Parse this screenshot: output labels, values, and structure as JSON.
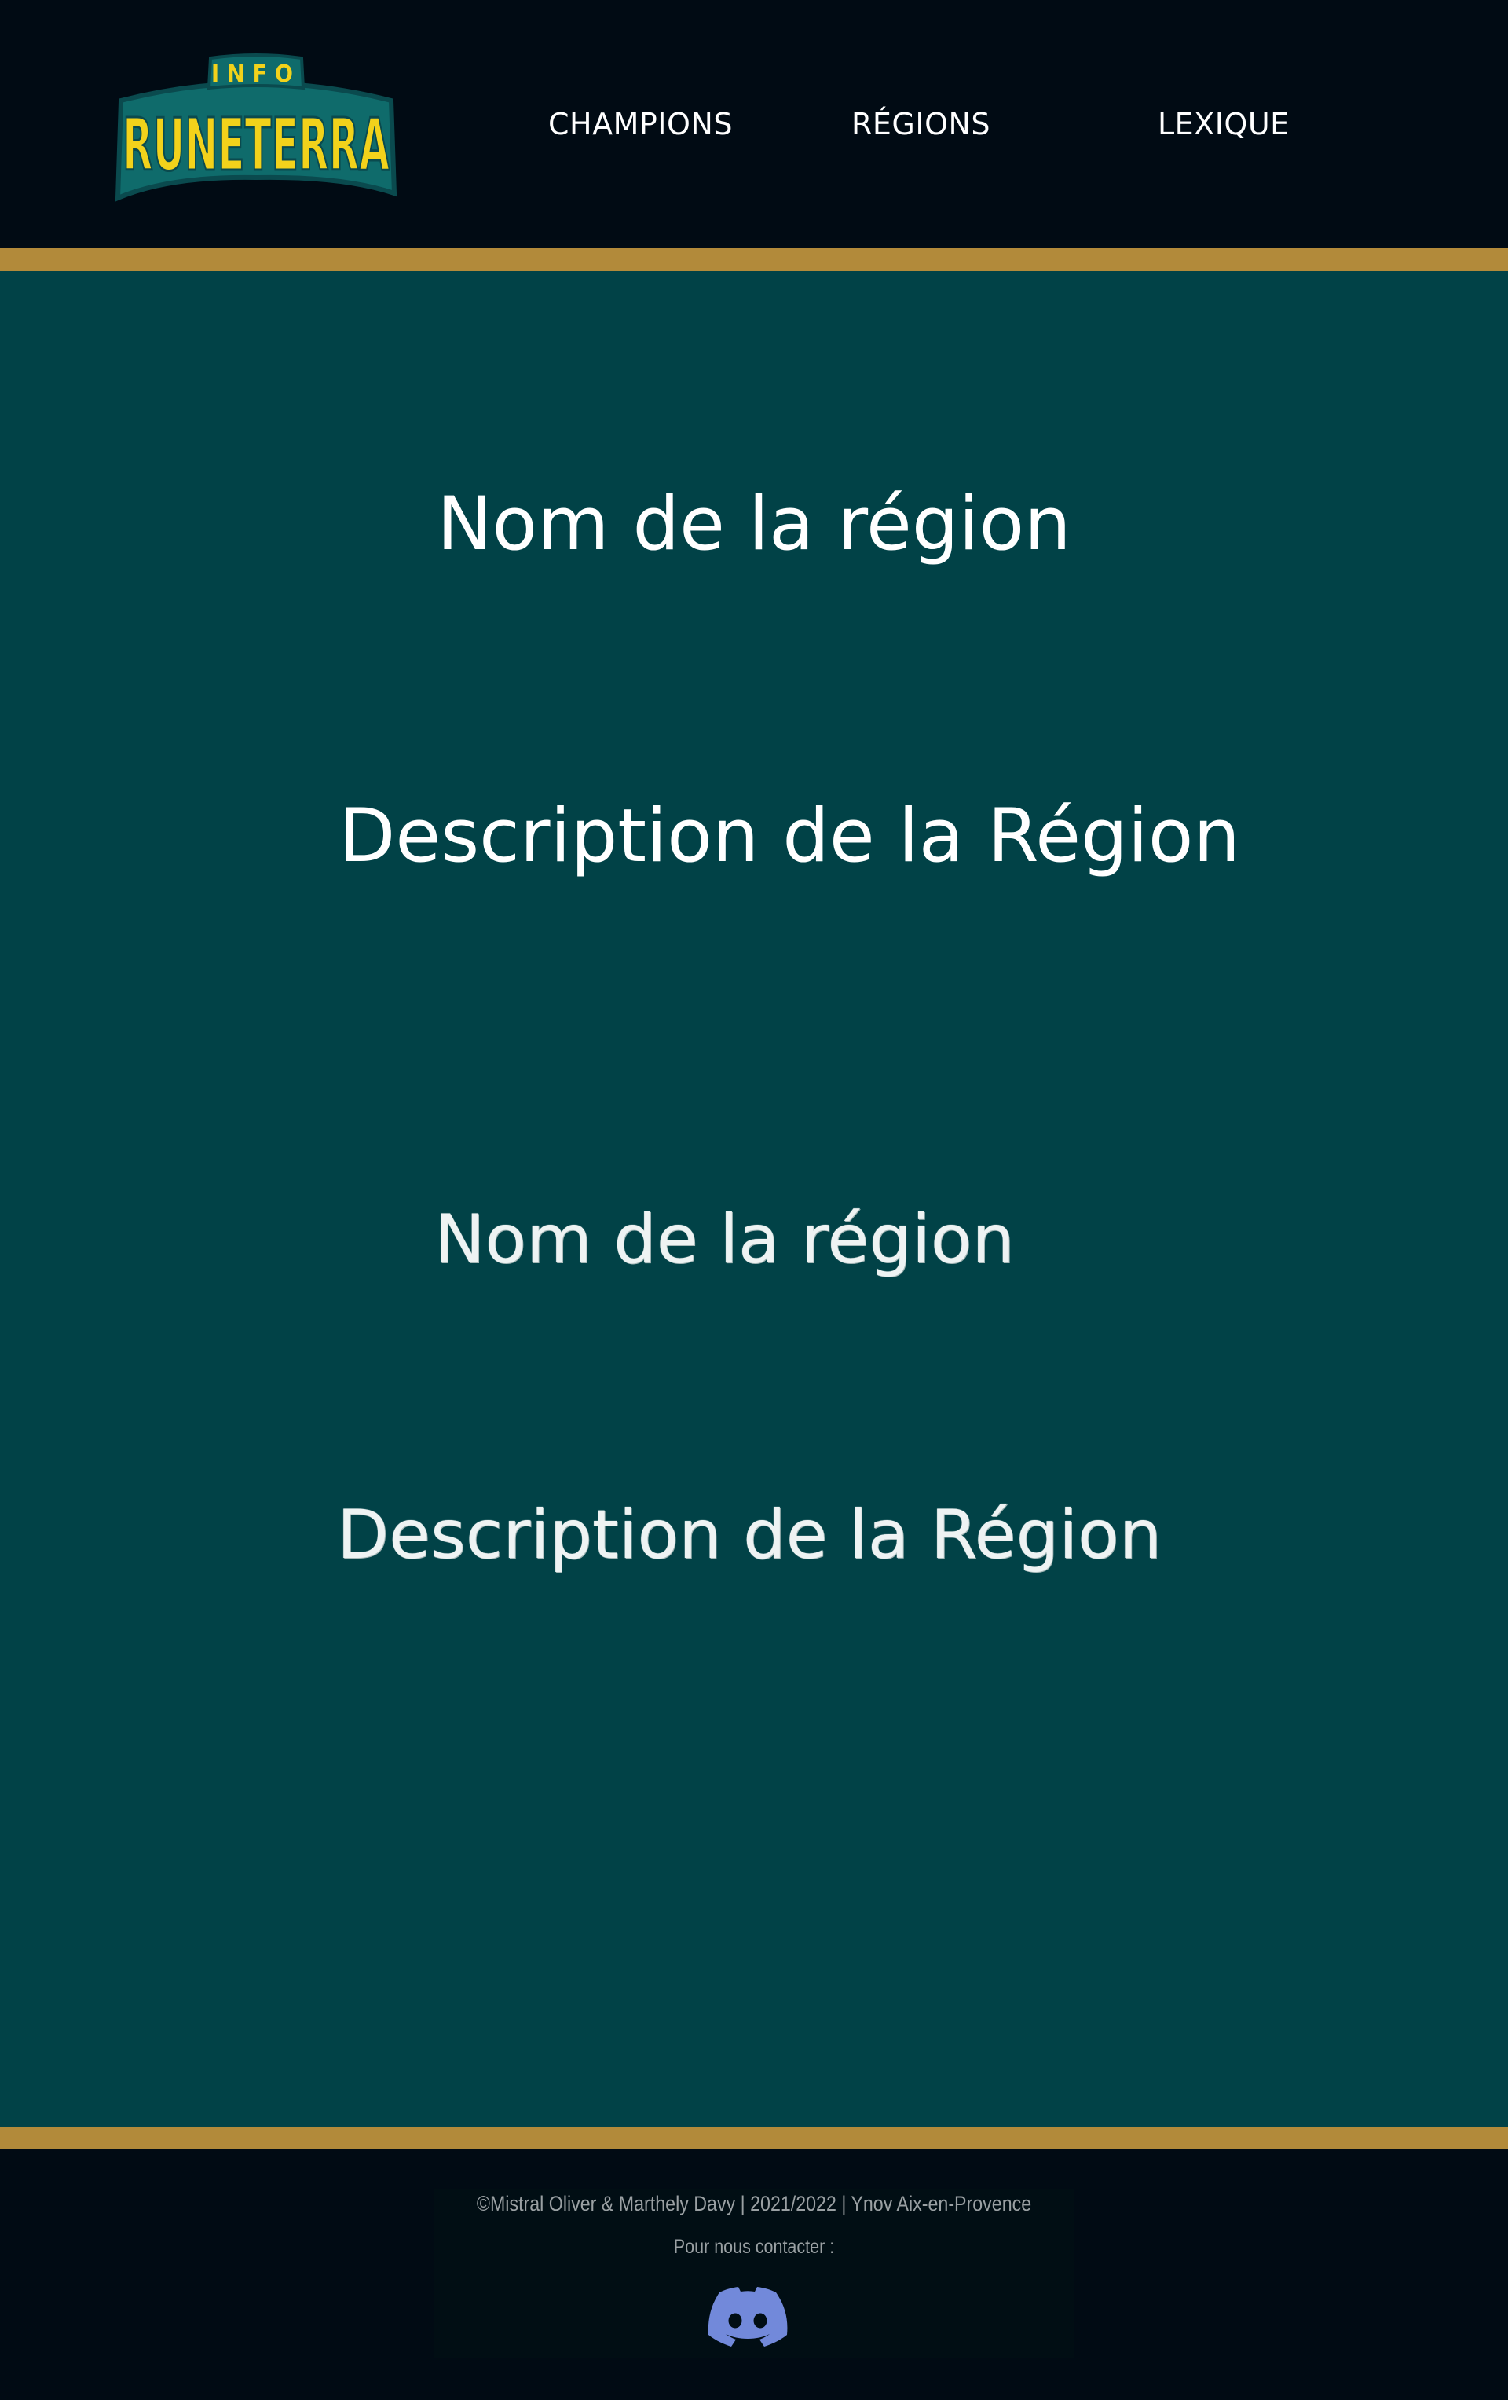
{
  "header": {
    "logo": {
      "top_text": "INFO",
      "main_text": "RUNETERRA"
    },
    "nav": [
      {
        "label": "CHAMPIONS"
      },
      {
        "label": "RÉGIONS"
      },
      {
        "label": "LEXIQUE"
      }
    ]
  },
  "main": {
    "regions": [
      {
        "name": "Nom de la région",
        "description": "Description de la Région"
      },
      {
        "name": "Nom de la région",
        "description": "Description de la Région"
      }
    ]
  },
  "footer": {
    "copyright": "©Mistral Oliver & Marthely Davy | 2021/2022 | Ynov Aix-en-Provence",
    "contact_label": "Pour nous contacter :",
    "contact_icon": "discord-icon"
  },
  "colors": {
    "header_bg": "#010b14",
    "gold_accent": "#b28a3a",
    "main_bg": "#014247",
    "logo_yellow": "#f2d21b",
    "logo_teal": "#0f6b6b",
    "discord_blurple": "#7289da"
  }
}
